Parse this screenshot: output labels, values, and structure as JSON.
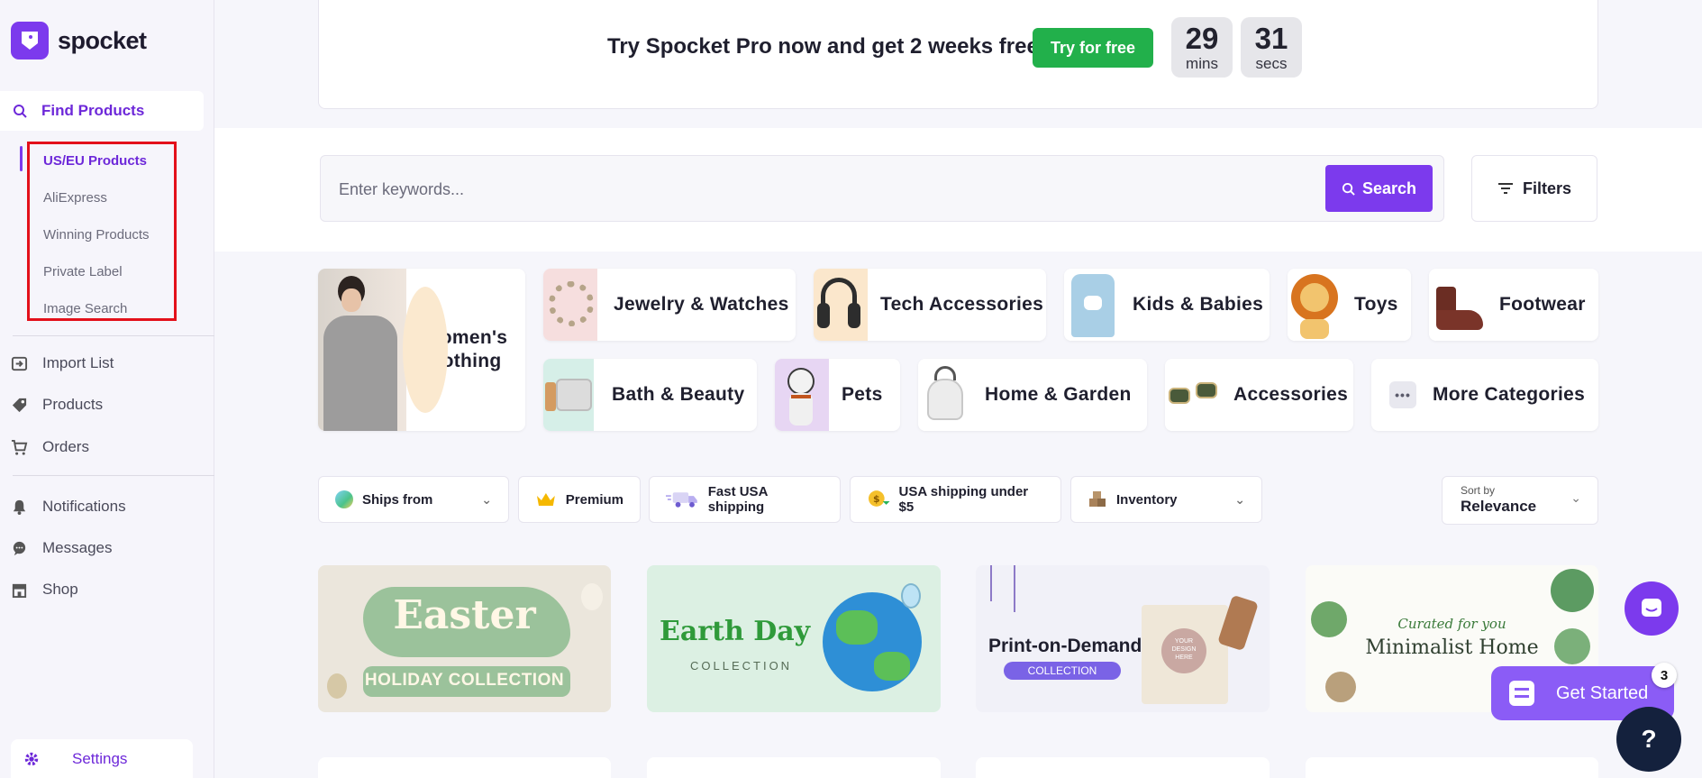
{
  "brand": {
    "name": "spocket",
    "accent": "#7c3aed"
  },
  "sidebar": {
    "find_products": "Find Products",
    "sub_items": [
      "US/EU Products",
      "AliExpress",
      "Winning Products",
      "Private Label",
      "Image Search"
    ],
    "nav": [
      {
        "label": "Import List",
        "icon": "import-list-icon"
      },
      {
        "label": "Products",
        "icon": "tag-icon"
      },
      {
        "label": "Orders",
        "icon": "cart-icon"
      },
      {
        "label": "Notifications",
        "icon": "bell-icon"
      },
      {
        "label": "Messages",
        "icon": "chat-bubble-icon"
      },
      {
        "label": "Shop",
        "icon": "store-icon"
      }
    ],
    "settings": "Settings"
  },
  "banner": {
    "text": "Try Spocket Pro now and get 2 weeks free!",
    "button": "Try for free",
    "mins_value": "29",
    "mins_label": "mins",
    "secs_value": "31",
    "secs_label": "secs"
  },
  "search": {
    "placeholder": "Enter keywords...",
    "button": "Search",
    "filters": "Filters"
  },
  "categories": {
    "womens": "Women's Clothing",
    "jewelry": "Jewelry & Watches",
    "tech": "Tech Accessories",
    "kids": "Kids & Babies",
    "toys": "Toys",
    "footwear": "Footwear",
    "bath": "Bath & Beauty",
    "pets": "Pets",
    "home": "Home & Garden",
    "accessories": "Accessories",
    "more": "More Categories"
  },
  "chips": {
    "ships_from": "Ships from",
    "premium": "Premium",
    "fast_usa": "Fast USA shipping",
    "usa_under5": "USA shipping under $5",
    "inventory": "Inventory"
  },
  "sort": {
    "label": "Sort by",
    "value": "Relevance"
  },
  "collections": {
    "easter_title": "Easter",
    "easter_sub": "HOLIDAY COLLECTION",
    "earth_title": "Earth Day",
    "earth_sub": "COLLECTION",
    "pod_title": "Print-on-Demand",
    "pod_sub": "COLLECTION",
    "pod_bag": "YOUR DESIGN HERE",
    "min_curated": "Curated for you",
    "min_title": "Minimalist Home"
  },
  "floating": {
    "get_started": "Get Started",
    "badge": "3",
    "help": "?"
  }
}
